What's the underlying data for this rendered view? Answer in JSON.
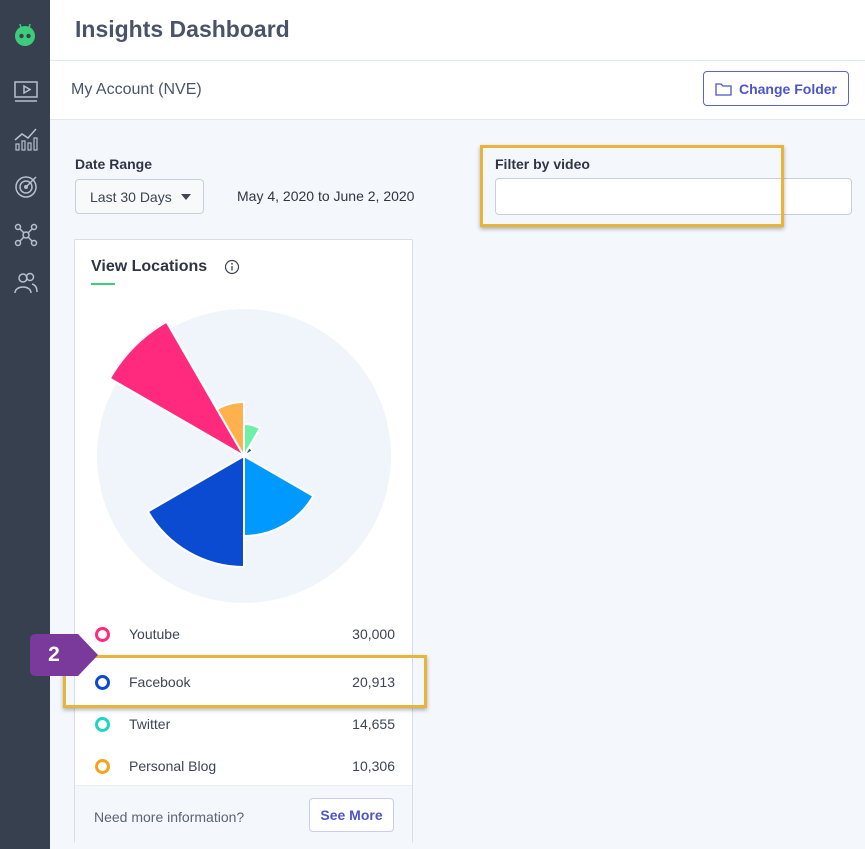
{
  "app": {
    "title": "Insights Dashboard",
    "account": "My Account (NVE)",
    "change_folder_label": "Change Folder"
  },
  "sidebar": {
    "items": [
      {
        "icon": "video-icon"
      },
      {
        "icon": "analytics-icon"
      },
      {
        "icon": "target-icon"
      },
      {
        "icon": "network-icon"
      },
      {
        "icon": "users-icon"
      }
    ]
  },
  "filters": {
    "date_range_label": "Date Range",
    "date_range_value": "Last 30 Days",
    "date_range_text": "May 4, 2020 to June 2, 2020",
    "video_label": "Filter by video",
    "video_value": ""
  },
  "card": {
    "title": "View Locations",
    "footer_text": "Need more information?",
    "see_more_label": "See More"
  },
  "chart_data": {
    "type": "polar-area",
    "title": "View Locations",
    "series": [
      {
        "name": "Youtube",
        "value": 30000,
        "value_label": "30,000",
        "color": "#ff2a7d"
      },
      {
        "name": "Facebook",
        "value": 20913,
        "value_label": "20,913",
        "color": "#0a4bd1"
      },
      {
        "name": "Twitter",
        "value": 14655,
        "value_label": "14,655",
        "color": "#20d5c4"
      },
      {
        "name": "Personal Blog",
        "value": 10306,
        "value_label": "10,306",
        "color": "#f7a21e"
      }
    ]
  },
  "annotations": {
    "step_number": "2",
    "highlight_color": "#e8b53a",
    "badge_color": "#7a3a9b"
  }
}
